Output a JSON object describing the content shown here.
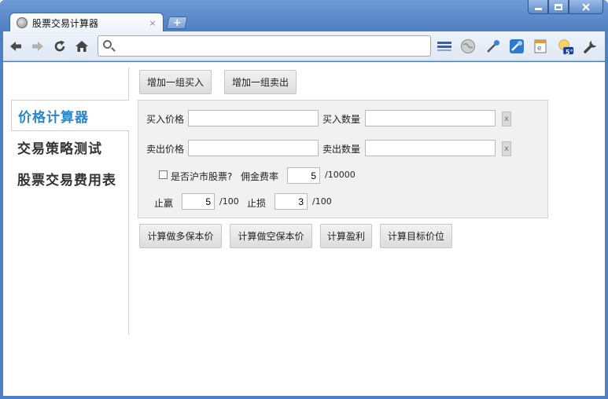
{
  "browser": {
    "tab_title": "股票交易计算器",
    "tab_close": "×",
    "new_tab": "+",
    "address_placeholder": "",
    "address_value": "",
    "weather_badge": "5°"
  },
  "nav": {
    "items": [
      {
        "label": "价格计算器",
        "active": true
      },
      {
        "label": "交易策略测试",
        "active": false
      },
      {
        "label": "股票交易费用表",
        "active": false
      }
    ]
  },
  "top_buttons": {
    "add_buy": "增加一组买入",
    "add_sell": "增加一组卖出"
  },
  "form": {
    "buy_price_label": "买入价格",
    "buy_qty_label": "买入数量",
    "sell_price_label": "卖出价格",
    "sell_qty_label": "卖出数量",
    "remove_label": "x",
    "sh_stock_label": "是否沪市股票?",
    "commission_label": "佣金费率",
    "commission_value": "5",
    "commission_unit": "/10000",
    "take_profit_label": "止赢",
    "take_profit_value": "5",
    "take_profit_unit": "/100",
    "stop_loss_label": "止损",
    "stop_loss_value": "3",
    "stop_loss_unit": "/100"
  },
  "actions": {
    "long_breakeven": "计算做多保本价",
    "short_breakeven": "计算做空保本价",
    "profit": "计算盈利",
    "target_price": "计算目标价位"
  }
}
